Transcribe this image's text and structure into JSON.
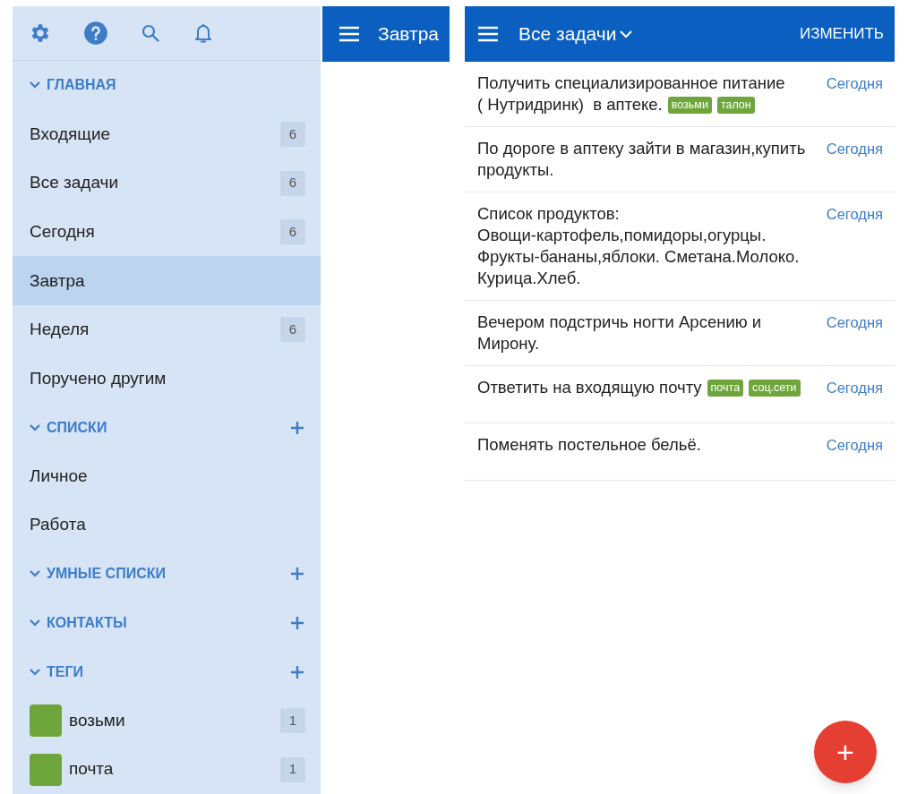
{
  "sidebar": {
    "sections": [
      {
        "title": "ГЛАВНАЯ",
        "expanded": true,
        "add_button": false,
        "items": [
          {
            "kind": "list",
            "label": "Входящие",
            "count": "6",
            "selected": false
          },
          {
            "kind": "list",
            "label": "Все задачи",
            "count": "6",
            "selected": false
          },
          {
            "kind": "list",
            "label": "Сегодня",
            "count": "6",
            "selected": false
          },
          {
            "kind": "list",
            "label": "Завтра",
            "selected": true
          },
          {
            "kind": "list",
            "label": "Неделя",
            "count": "6",
            "selected": false
          },
          {
            "kind": "list",
            "label": "Поручено другим",
            "selected": false
          }
        ]
      },
      {
        "title": "СПИСКИ",
        "expanded": true,
        "add_button": true,
        "items": [
          {
            "kind": "list",
            "label": "Личное",
            "selected": false
          },
          {
            "kind": "list",
            "label": "Работа",
            "selected": false
          }
        ]
      },
      {
        "title": "УМНЫЕ СПИСКИ",
        "expanded": true,
        "add_button": true
      },
      {
        "title": "КОНТАКТЫ",
        "expanded": true,
        "add_button": true
      },
      {
        "title": "ТЕГИ",
        "expanded": true,
        "add_button": true,
        "items": [
          {
            "kind": "tag",
            "label": "возьми",
            "count": "1",
            "color": "#6fa63c",
            "selected": false
          },
          {
            "kind": "tag",
            "label": "почта",
            "count": "1",
            "color": "#6fa63c",
            "selected": false
          }
        ]
      }
    ]
  },
  "middle_panel": {
    "title": "Завтра"
  },
  "task_panel": {
    "title": "Все задачи",
    "edit_button": "ИЗМЕНИТЬ",
    "tasks": [
      {
        "text": "Получить специализированное питание\n( Нутридринк)  в аптеке.",
        "tags": [
          "возьми",
          "талон"
        ],
        "date": "Сегодня"
      },
      {
        "text": "По дороге в аптеку зайти в магазин,купить продукты.",
        "date": "Сегодня"
      },
      {
        "text": "Список продуктов:\nОвощи-картофель,помидоры,огурцы.\nФрукты-бананы,яблоки. Сметана.Молоко.\nКурица.Хлеб.",
        "date": "Сегодня"
      },
      {
        "text": "Вечером подстричь ногти Арсению и Мирону.",
        "date": "Сегодня"
      },
      {
        "text": "Ответить на входящую почту",
        "tags": [
          "почта",
          "соц.сети"
        ],
        "date": "Сегодня"
      },
      {
        "text": "Поменять постельное бельё.",
        "date": "Сегодня"
      }
    ]
  },
  "fab": {
    "label": "+"
  }
}
